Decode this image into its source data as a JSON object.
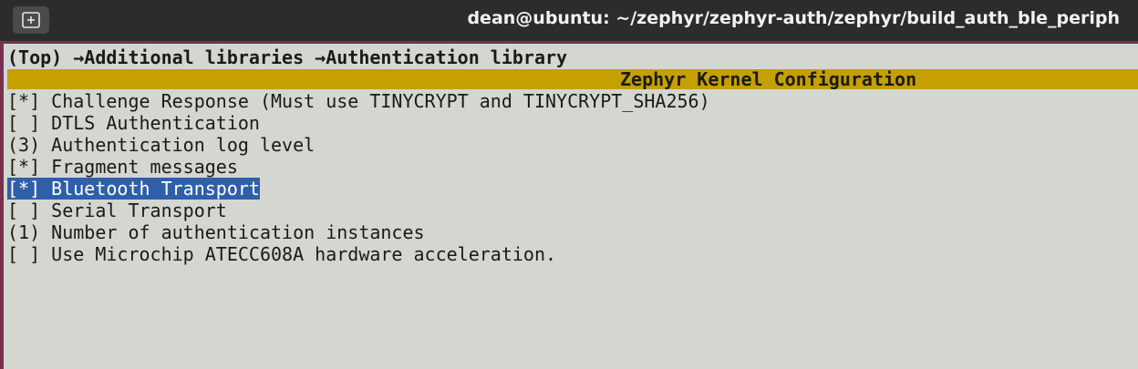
{
  "window": {
    "title": "dean@ubuntu: ~/zephyr/zephyr-auth/zephyr/build_auth_ble_periph",
    "new_tab_icon": "new-tab-icon"
  },
  "breadcrumb": {
    "text": "(Top) →Additional libraries →Authentication library"
  },
  "header": {
    "title": "Zephyr Kernel Configuration"
  },
  "menu": {
    "items": [
      {
        "text": "[*] Challenge Response (Must use TINYCRYPT and TINYCRYPT_SHA256)"
      },
      {
        "text": "[ ] DTLS Authentication"
      },
      {
        "text": "(3) Authentication log level"
      },
      {
        "text": "[*] Fragment messages"
      },
      {
        "text": "[*] Bluetooth Transport"
      },
      {
        "text": "[ ] Serial Transport"
      },
      {
        "text": "(1) Number of authentication instances"
      },
      {
        "text": "[ ] Use Microchip ATECC608A hardware acceleration."
      }
    ],
    "selected_index": 4
  },
  "colors": {
    "header_bar": "#c4a000",
    "selection": "#2f5fa8",
    "terminal_bg": "#d4d6d0"
  }
}
